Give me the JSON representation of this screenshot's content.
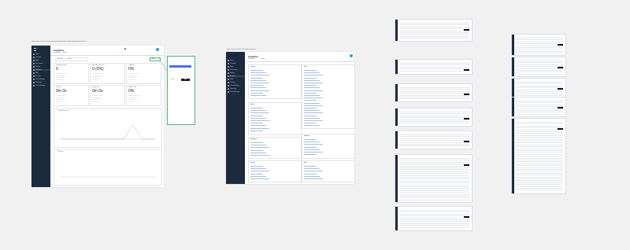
{
  "frame1": {
    "url": "https://app.cloud.com/analytics/portal/report/userActivity/dashboard?i=1",
    "app_title": "Analytics",
    "tabs": [
      "Dashboards",
      "Reports"
    ],
    "filter_label": "Last 7 days",
    "search_placeholder": "Search",
    "export_label": "Export",
    "nav": [
      "Home",
      "Calendar",
      "Apps",
      "Documents",
      "Activity",
      "Analytics",
      "Help",
      "Account",
      "Users Meeting",
      "Reporting",
      "Users Manager"
    ],
    "section_label": "Admin",
    "kpis": [
      {
        "label": "Total Apps Accessed",
        "value": "0"
      },
      {
        "label": "Unique Apps Accessed",
        "value": "0 (0%)"
      },
      {
        "label": "Completion",
        "value": "0%"
      },
      {
        "label": "Total Time",
        "value": "0m 0s"
      },
      {
        "label": "Average Time",
        "value": "0m 0s"
      },
      {
        "label": "Utilization Rate",
        "value": "0%"
      }
    ],
    "chart1_title": "Total Apps Accessed",
    "chart2_title": "Total Users",
    "dropdown_items": [
      "Option A",
      "Option B",
      "Option C"
    ],
    "dropdown_apply": "Apply",
    "dropdown_cancel": "Cancel"
  },
  "frame2": {
    "url": "https://app.cloud.com/analytics/reports",
    "app_title": "Analytics",
    "tabs": [
      "Dashboards",
      "Reports"
    ],
    "sections": [
      {
        "title": "Overview"
      },
      {
        "title": "Usage"
      },
      {
        "title": "Activity"
      },
      {
        "title": "Application"
      },
      {
        "title": "Engagement"
      },
      {
        "title": "Security"
      },
      {
        "title": "Audit"
      }
    ]
  }
}
